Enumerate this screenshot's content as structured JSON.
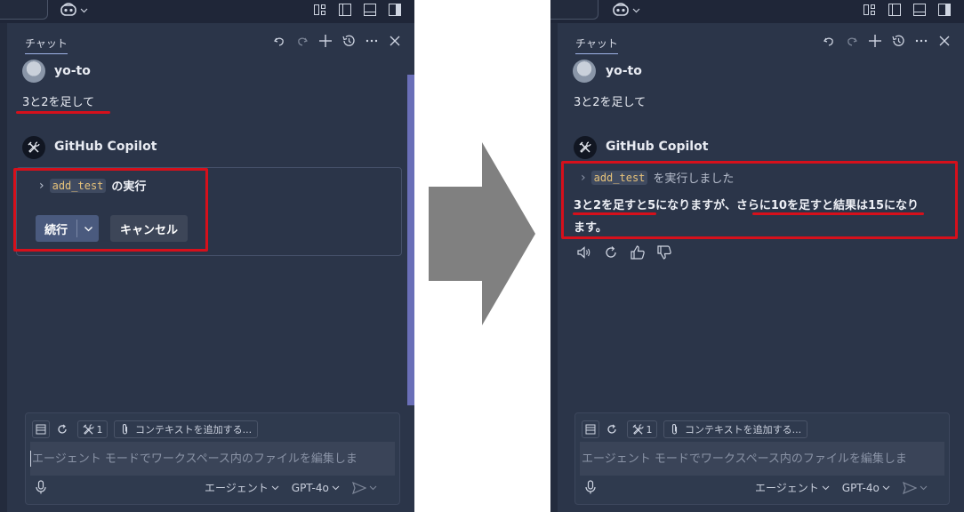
{
  "chat": {
    "tab_label": "チャット",
    "user_name": "yo-to",
    "user_message": "3と2を足して",
    "copilot_name": "GitHub Copilot"
  },
  "before": {
    "tool_name": "add_test",
    "tool_action": "の実行",
    "continue_label": "続行",
    "cancel_label": "キャンセル"
  },
  "after": {
    "tool_name": "add_test",
    "tool_result": "を実行しました",
    "response_line1": "3と2を足すと5になりますが、さらに10を足すと結果は15になり",
    "response_line2": "ます。"
  },
  "composer": {
    "tools_count": "1",
    "add_context_label": "コンテキストを追加する...",
    "input_placeholder": "エージェント モードでワークスペース内のファイルを編集しま",
    "mode_label": "エージェント",
    "model_label": "GPT-4o"
  },
  "colors": {
    "panel_bg": "#2b3549",
    "highlight_red": "#d6101b",
    "arrow_gray": "#808080",
    "scrollbar": "#6a6fb8"
  }
}
